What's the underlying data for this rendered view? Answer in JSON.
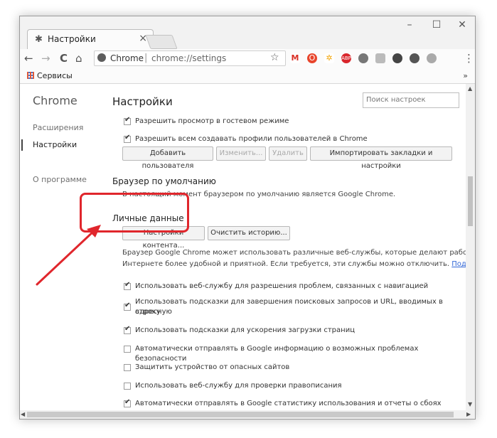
{
  "window": {
    "tab_title": "Настройки",
    "tab_close": "×",
    "controls": [
      "–",
      "☐",
      "✕"
    ]
  },
  "toolbar": {
    "back": "←",
    "forward": "→",
    "reload": "C",
    "home": "⌂",
    "site": "Chrome",
    "separator": "|",
    "url": "chrome://settings",
    "star": "☆",
    "menu": "⋮",
    "extensions": [
      "gmail-icon",
      "opera-icon",
      "puzzle-icon",
      "adblock-icon",
      "extension-icon",
      "extension-icon",
      "extension-icon",
      "extension-icon",
      "extension-icon"
    ]
  },
  "bookmarks": {
    "apps_label": "Сервисы",
    "more": "»"
  },
  "sidebar": {
    "title": "Chrome",
    "items": [
      {
        "label": "Расширения"
      },
      {
        "label": "Настройки"
      },
      {
        "label": "О программе"
      }
    ]
  },
  "main": {
    "title": "Настройки",
    "search_placeholder": "Поиск настроек",
    "users": {
      "checks": [
        {
          "label": "Разрешить просмотр в гостевом режиме",
          "checked": true
        },
        {
          "label": "Разрешить всем создавать профили пользователей в Chrome",
          "checked": true
        }
      ],
      "buttons": [
        "Добавить пользователя",
        "Изменить...",
        "Удалить",
        "Импортировать закладки и настройки"
      ]
    },
    "default_browser": {
      "title": "Браузер по умолчанию",
      "text": "В настоящий момент браузером по умолчанию является Google Chrome."
    },
    "privacy": {
      "title": "Личные данные",
      "buttons": [
        "Настройки контента...",
        "Очистить историю..."
      ],
      "desc_line1": "Браузер Google Chrome может использовать различные веб-службы, которые делают работу в",
      "desc_line2": "Интернете более удобной и приятной. Если требуется, эти службы можно отключить. ",
      "more_link": "Подробнее...",
      "checks": [
        {
          "label": "Использовать веб-службу для разрешения проблем, связанных с навигацией",
          "checked": true
        },
        {
          "label": "Использовать подсказки для завершения поисковых запросов и URL, вводимых в адресную",
          "checked": true
        },
        {
          "label": "строку",
          "checked": null
        },
        {
          "label": "Использовать подсказки для ускорения загрузки страниц",
          "checked": true
        },
        {
          "label": "Автоматически отправлять в Google информацию о возможных проблемах безопасности",
          "checked": false
        },
        {
          "label": "Защитить устройство от опасных сайтов",
          "checked": false
        },
        {
          "label": "Использовать веб-службу для проверки правописания",
          "checked": false
        },
        {
          "label": "Автоматически отправлять в Google статистику использования и отчеты о сбоях",
          "checked": true
        }
      ]
    }
  },
  "colors": {
    "highlight": "#e0262c",
    "link": "#3367d6"
  }
}
